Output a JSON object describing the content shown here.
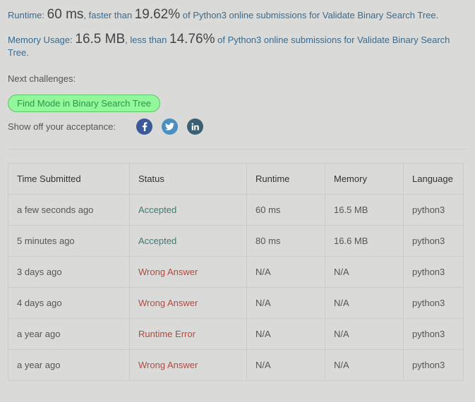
{
  "runtime": {
    "label": "Runtime:",
    "value": "60 ms",
    "faster_text": ", faster than",
    "percent": "19.62%",
    "suffix": "of Python3 online submissions for Validate Binary Search Tree."
  },
  "memory": {
    "label": "Memory Usage:",
    "value": "16.5 MB",
    "less_text": ", less than",
    "percent": "14.76%",
    "suffix": "of Python3 online submissions for Validate Binary Search Tree."
  },
  "next_challenges": {
    "label": "Next challenges:",
    "items": [
      "Find Mode in Binary Search Tree"
    ]
  },
  "share": {
    "label": "Show off your acceptance:",
    "icons": [
      {
        "name": "facebook-icon",
        "color": "#3b5998"
      },
      {
        "name": "twitter-icon",
        "color": "#4a8fc0"
      },
      {
        "name": "linkedin-icon",
        "color": "#3a6072"
      }
    ]
  },
  "colors": {
    "accepted": "#3c7a76",
    "error": "#b4493d",
    "next_challenge_bg": "#93f79b"
  },
  "table": {
    "headers": [
      "Time Submitted",
      "Status",
      "Runtime",
      "Memory",
      "Language"
    ],
    "rows": [
      [
        "a few seconds ago",
        "Accepted",
        "60 ms",
        "16.5 MB",
        "python3"
      ],
      [
        "5 minutes ago",
        "Accepted",
        "80 ms",
        "16.6 MB",
        "python3"
      ],
      [
        "3 days ago",
        "Wrong Answer",
        "N/A",
        "N/A",
        "python3"
      ],
      [
        "4 days ago",
        "Wrong Answer",
        "N/A",
        "N/A",
        "python3"
      ],
      [
        "a year ago",
        "Runtime Error",
        "N/A",
        "N/A",
        "python3"
      ],
      [
        "a year ago",
        "Wrong Answer",
        "N/A",
        "N/A",
        "python3"
      ]
    ]
  }
}
